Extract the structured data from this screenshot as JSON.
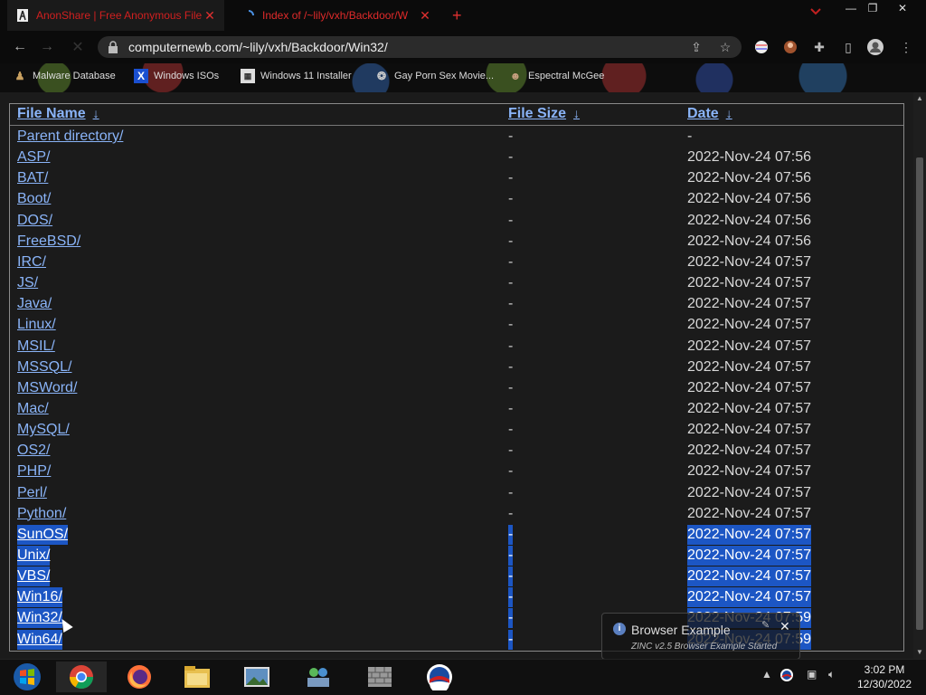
{
  "tabs": [
    {
      "title": "AnonShare | Free Anonymous File",
      "close": "✕"
    },
    {
      "title": "Index of /~lily/vxh/Backdoor/W",
      "close": "✕"
    }
  ],
  "new_tab": "+",
  "tab_search_icon": "chevron-down",
  "window_controls": {
    "minimize": "—",
    "maximize": "❐",
    "close": "✕"
  },
  "nav": {
    "back": "←",
    "forward": "→",
    "reload": "✕"
  },
  "address": {
    "url": "computernewb.com/~lily/vxh/Backdoor/Win32/"
  },
  "bookmarks": [
    {
      "label": "Malware Database",
      "icon": "user-icon"
    },
    {
      "label": "Windows ISOs",
      "icon": "x-logo-icon"
    },
    {
      "label": "Windows 11 Installer",
      "icon": "page-icon"
    },
    {
      "label": "Gay Porn Sex Movie...",
      "icon": "globe-icon"
    },
    {
      "label": "Espectral McGee",
      "icon": "ghost-icon"
    }
  ],
  "listing": {
    "headers": {
      "name": "File Name",
      "size": "File Size",
      "date": "Date",
      "sort": "↓"
    },
    "rows": [
      {
        "name": "Parent directory/",
        "size": "-",
        "date": "-"
      },
      {
        "name": "ASP/",
        "size": "-",
        "date": "2022-Nov-24 07:56"
      },
      {
        "name": "BAT/",
        "size": "-",
        "date": "2022-Nov-24 07:56"
      },
      {
        "name": "Boot/",
        "size": "-",
        "date": "2022-Nov-24 07:56"
      },
      {
        "name": "DOS/",
        "size": "-",
        "date": "2022-Nov-24 07:56"
      },
      {
        "name": "FreeBSD/",
        "size": "-",
        "date": "2022-Nov-24 07:56"
      },
      {
        "name": "IRC/",
        "size": "-",
        "date": "2022-Nov-24 07:57"
      },
      {
        "name": "JS/",
        "size": "-",
        "date": "2022-Nov-24 07:57"
      },
      {
        "name": "Java/",
        "size": "-",
        "date": "2022-Nov-24 07:57"
      },
      {
        "name": "Linux/",
        "size": "-",
        "date": "2022-Nov-24 07:57"
      },
      {
        "name": "MSIL/",
        "size": "-",
        "date": "2022-Nov-24 07:57"
      },
      {
        "name": "MSSQL/",
        "size": "-",
        "date": "2022-Nov-24 07:57"
      },
      {
        "name": "MSWord/",
        "size": "-",
        "date": "2022-Nov-24 07:57"
      },
      {
        "name": "Mac/",
        "size": "-",
        "date": "2022-Nov-24 07:57"
      },
      {
        "name": "MySQL/",
        "size": "-",
        "date": "2022-Nov-24 07:57"
      },
      {
        "name": "OS2/",
        "size": "-",
        "date": "2022-Nov-24 07:57"
      },
      {
        "name": "PHP/",
        "size": "-",
        "date": "2022-Nov-24 07:57"
      },
      {
        "name": "Perl/",
        "size": "-",
        "date": "2022-Nov-24 07:57"
      },
      {
        "name": "Python/",
        "size": "-",
        "date": "2022-Nov-24 07:57"
      },
      {
        "name": "SunOS/",
        "size": "-",
        "date": "2022-Nov-24 07:57",
        "selected": true
      },
      {
        "name": "Unix/",
        "size": "-",
        "date": "2022-Nov-24 07:57",
        "selected": true
      },
      {
        "name": "VBS/",
        "size": "-",
        "date": "2022-Nov-24 07:57",
        "selected": true
      },
      {
        "name": "Win16/",
        "size": "-",
        "date": "2022-Nov-24 07:57",
        "selected": true
      },
      {
        "name": "Win32/",
        "size": "-",
        "date": "2022-Nov-24 07:59",
        "selected": true
      },
      {
        "name": "Win64/",
        "size": "-",
        "date": "2022-Nov-24 07:59",
        "selected": true
      }
    ]
  },
  "notification": {
    "title": "Browser Example",
    "message": "ZINC v2.5 Browser Example Started",
    "info": "i",
    "close": "✕",
    "pin": "✎"
  },
  "taskbar": {
    "apps": [
      "start-icon",
      "chrome-icon",
      "firefox-icon",
      "file-explorer-icon",
      "photo-viewer-icon",
      "network-icon",
      "firewall-icon",
      "obama-icon"
    ],
    "clock": {
      "time": "3:02 PM",
      "date": "12/30/2022"
    },
    "tray_arrow": "▲"
  },
  "colors": {
    "link": "#8ab4f8",
    "selection": "#1c56c4",
    "tab_text": "#e02a2a"
  }
}
